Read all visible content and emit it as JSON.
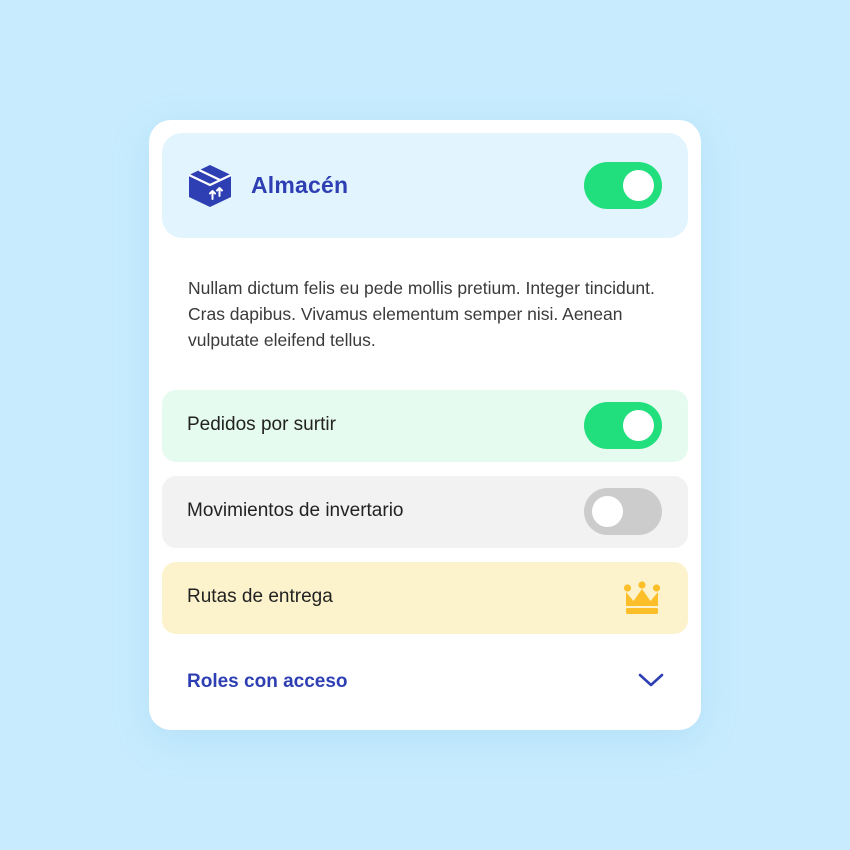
{
  "header": {
    "title": "Almacén",
    "icon": "warehouse-box-icon",
    "enabled": true
  },
  "description": "Nullam dictum felis eu pede mollis pretium. Integer tincidunt. Cras dapibus. Vivamus elementum semper nisi. Aenean vulputate eleifend tellus.",
  "options": [
    {
      "label": "Pedidos por surtir",
      "control": "toggle",
      "enabled": true
    },
    {
      "label": "Movimientos de invertario",
      "control": "toggle",
      "enabled": false
    },
    {
      "label": "Rutas de entrega",
      "control": "premium-crown",
      "icon": "crown-icon"
    }
  ],
  "roles": {
    "label": "Roles con acceso",
    "icon": "chevron-down-icon",
    "expanded": false
  },
  "colors": {
    "background": "#c8ecfe",
    "accent": "#2e3fb3",
    "toggle_on": "#22df7e",
    "toggle_off": "#cccccc",
    "header_bg": "#e2f5fe",
    "row_enabled_bg": "#e5fbef",
    "row_disabled_bg": "#f2f2f2",
    "row_premium_bg": "#fcf3cc",
    "crown": "#fcbf29"
  }
}
